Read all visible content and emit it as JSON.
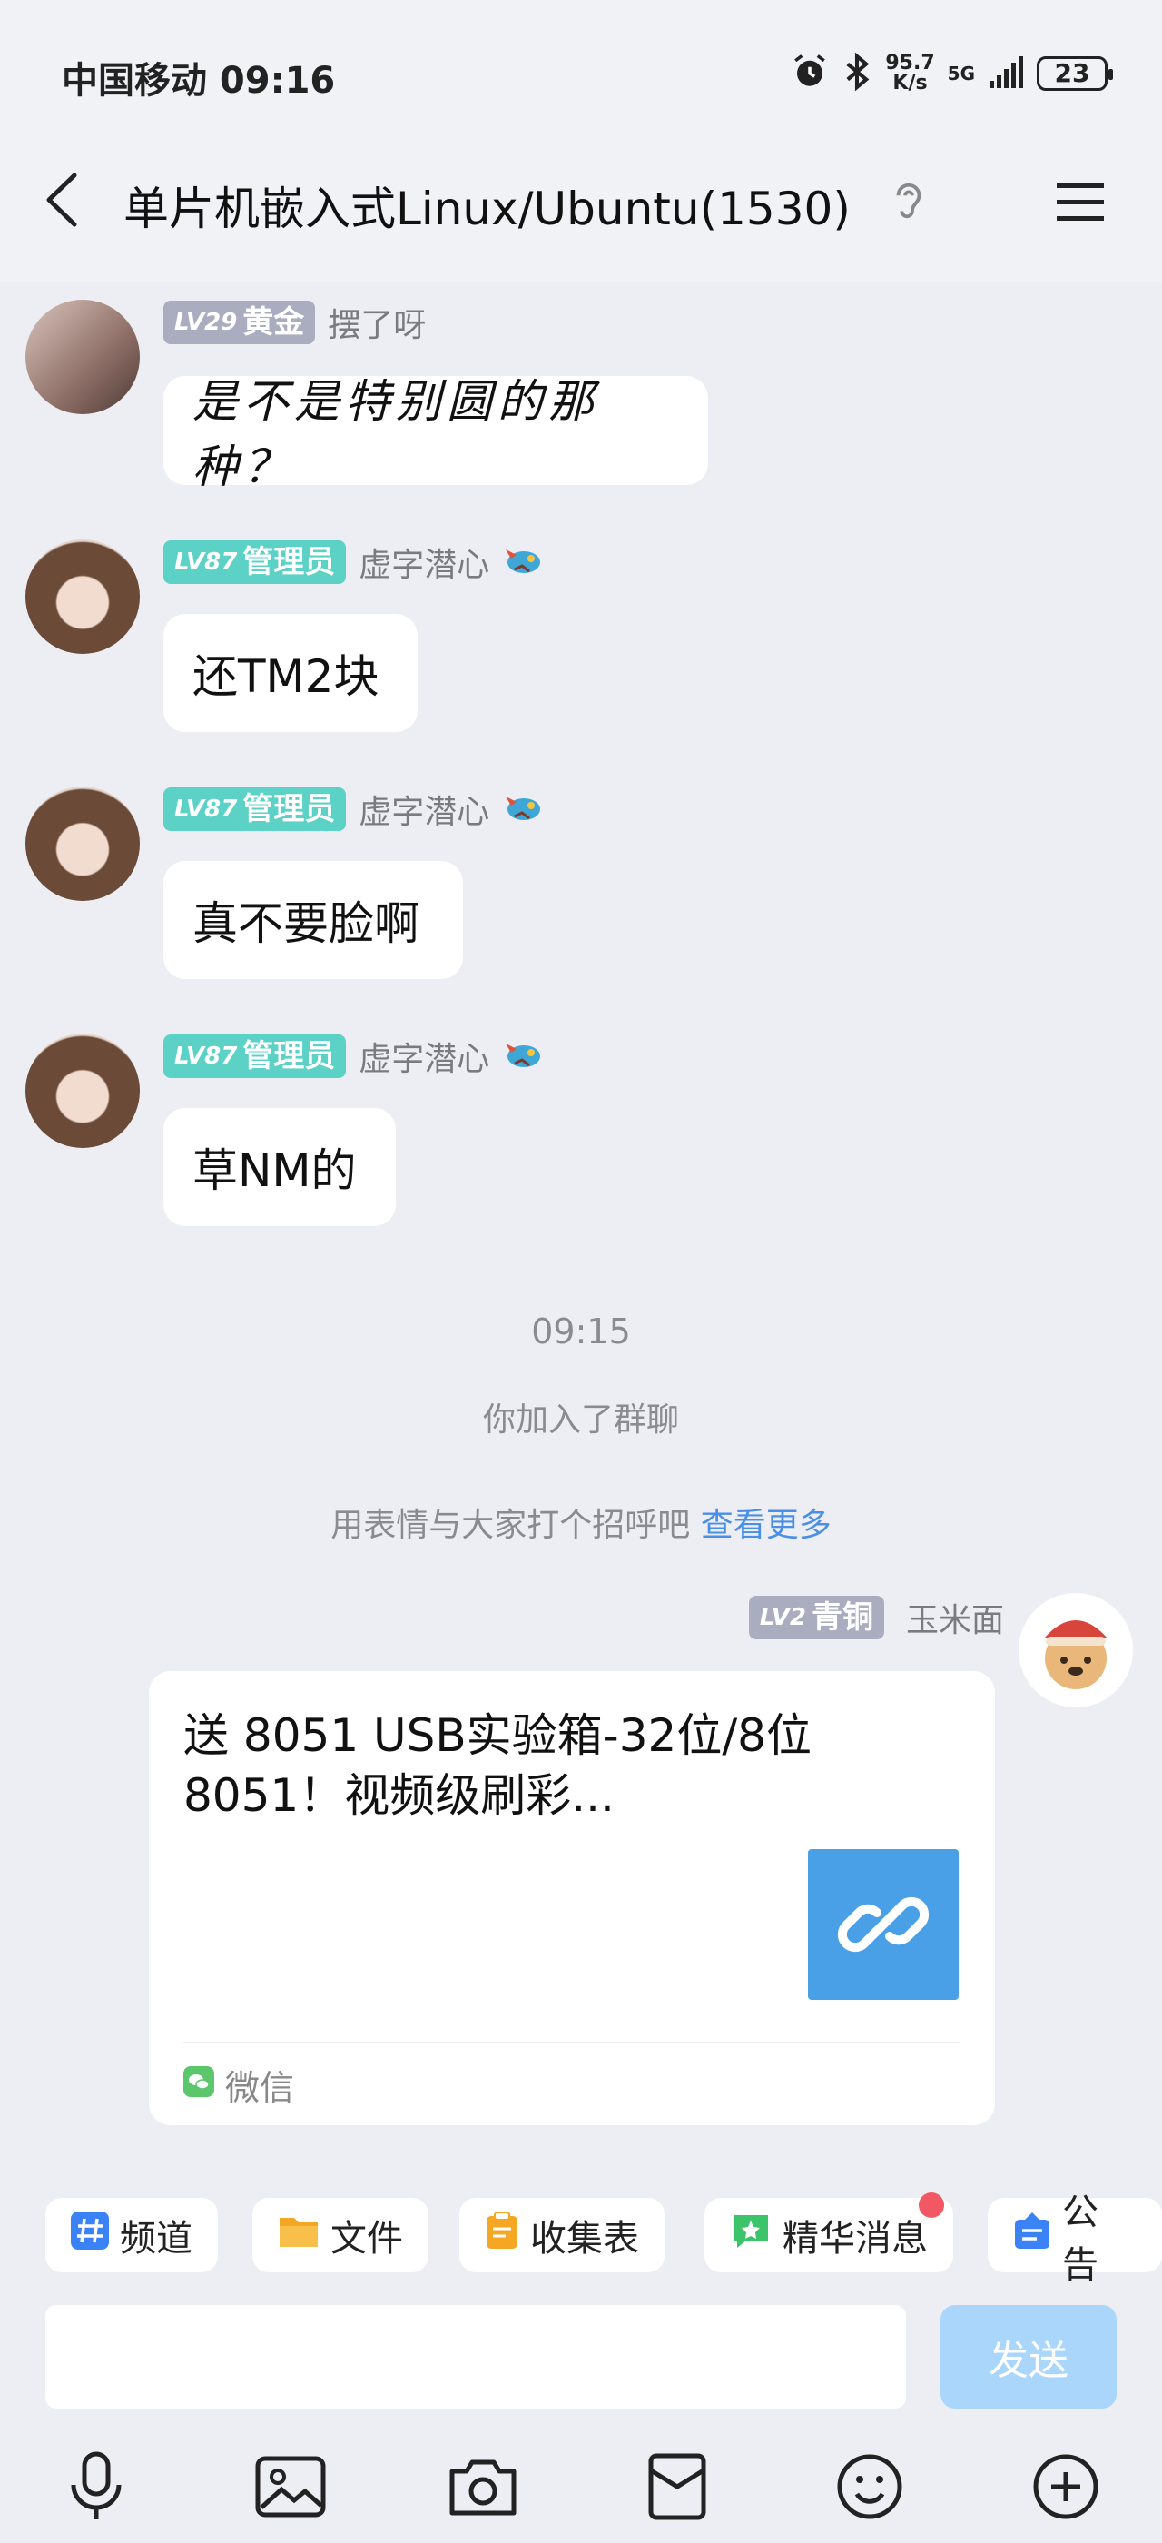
{
  "status_bar": {
    "carrier_time": "中国移动 09:16",
    "net_speed_value": "95.7",
    "net_speed_unit": "K/s",
    "network": "5G",
    "battery": "23"
  },
  "header": {
    "title": "单片机嵌入式Linux/Ubuntu(1530)"
  },
  "messages": [
    {
      "level": "LV29",
      "role": "黄金",
      "name": "摆了呀",
      "text": "是不是特别圆的那种？"
    },
    {
      "level": "LV87",
      "role": "管理员",
      "name": "虚字潜心",
      "text": "还TM2块"
    },
    {
      "level": "LV87",
      "role": "管理员",
      "name": "虚字潜心",
      "text": "真不要脸啊"
    },
    {
      "level": "LV87",
      "role": "管理员",
      "name": "虚字潜心",
      "text": "草NM的"
    }
  ],
  "system": {
    "time": "09:15",
    "joined": "你加入了群聊",
    "greet": "用表情与大家打个招呼吧",
    "greet_link": "查看更多"
  },
  "own_message": {
    "level": "LV2",
    "role": "青铜",
    "name": "玉米面",
    "card_title": "送 8051 USB实验箱-32位/8位8051！视频级刷彩...",
    "card_source": "微信"
  },
  "toolbar": {
    "items": [
      "频道",
      "文件",
      "收集表",
      "精华消息",
      "公告"
    ]
  },
  "input": {
    "send_label": "发送"
  },
  "colors": {
    "admin_badge": "#5cd1c6",
    "level_badge": "#a9adbf",
    "link": "#4a8fe6",
    "send_button": "#a9d6fa",
    "card_thumb": "#4aa0e6"
  }
}
